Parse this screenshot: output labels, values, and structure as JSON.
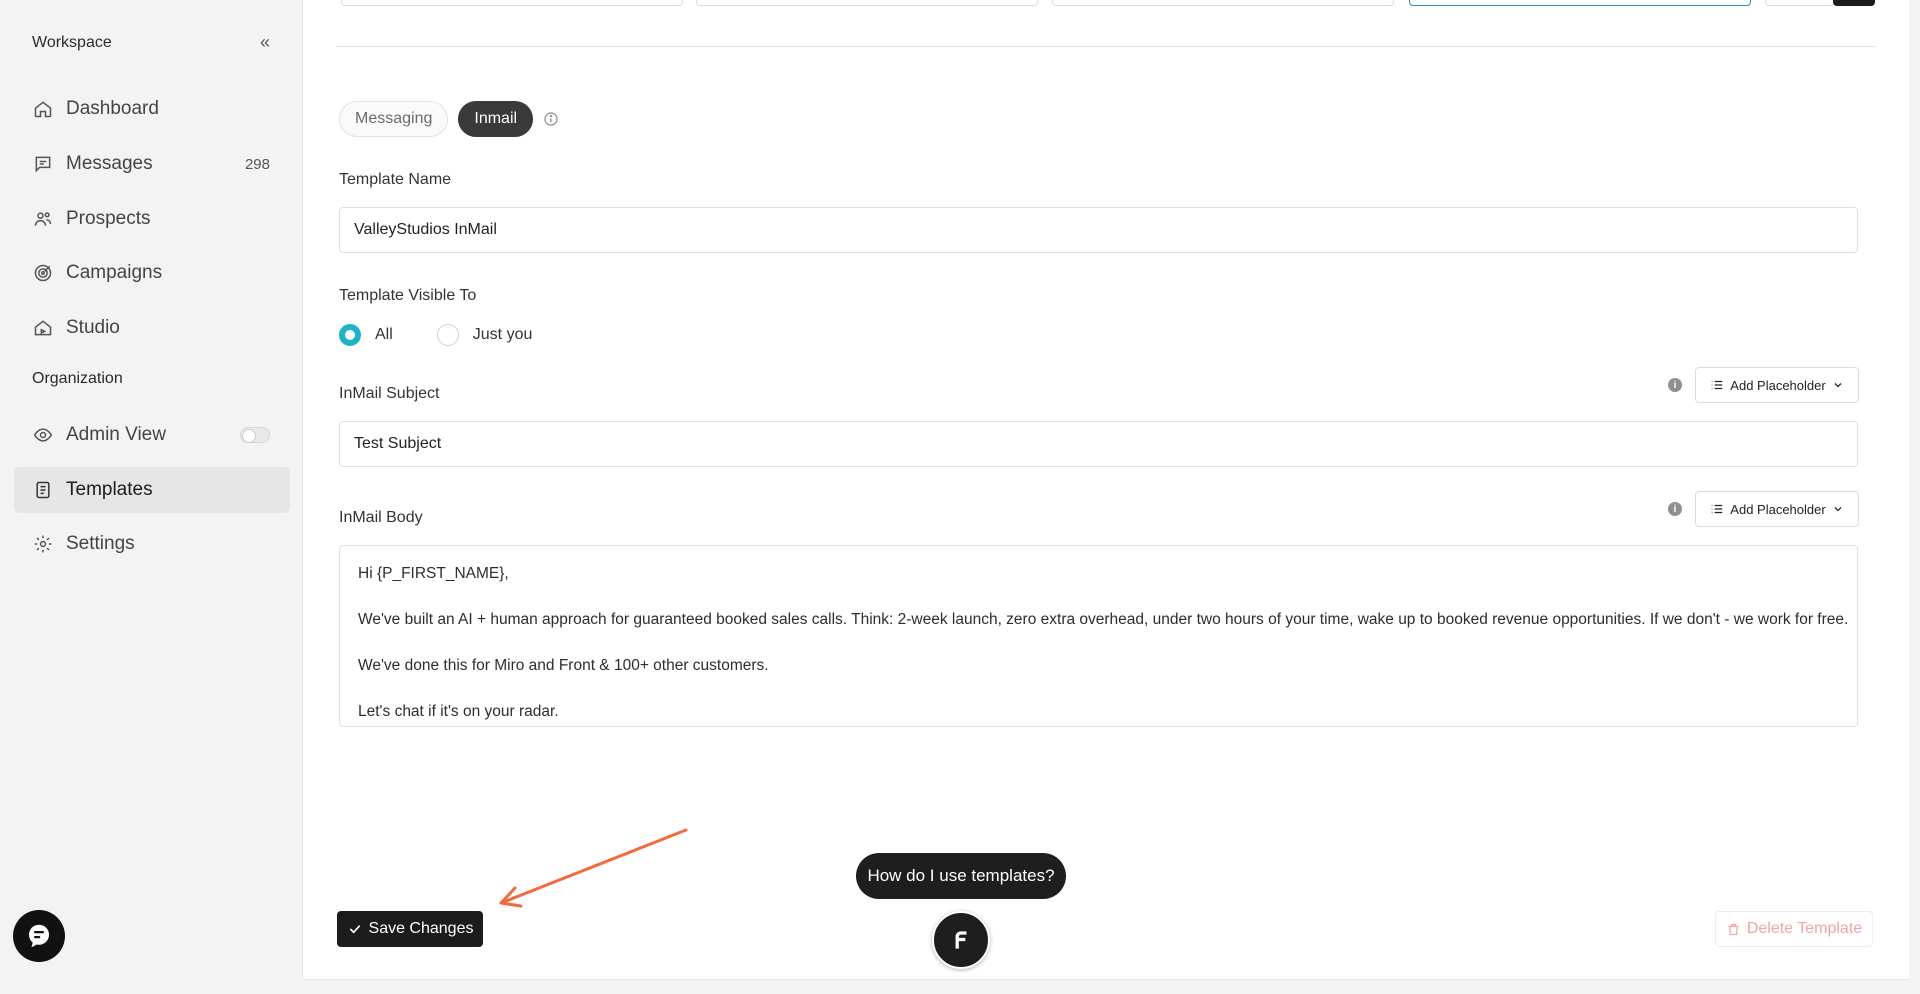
{
  "sidebar": {
    "workspace_label": "Workspace",
    "collapse_glyph": "«",
    "items": [
      {
        "label": "Dashboard",
        "icon": "home-icon"
      },
      {
        "label": "Messages",
        "icon": "message-icon",
        "count": "298"
      },
      {
        "label": "Prospects",
        "icon": "users-icon"
      },
      {
        "label": "Campaigns",
        "icon": "target-icon"
      },
      {
        "label": "Studio",
        "icon": "studio-icon"
      }
    ],
    "organization_label": "Organization",
    "org_items": [
      {
        "label": "Admin View",
        "icon": "eye-icon",
        "toggle": false
      },
      {
        "label": "Templates",
        "icon": "document-icon",
        "active": true
      },
      {
        "label": "Settings",
        "icon": "gear-icon"
      }
    ]
  },
  "tabs": {
    "messaging": "Messaging",
    "inmail": "Inmail",
    "active": "Inmail"
  },
  "form": {
    "template_name_label": "Template Name",
    "template_name_value": "ValleyStudios InMail",
    "visible_to_label": "Template Visible To",
    "visibility_options": [
      "All",
      "Just you"
    ],
    "visibility_selected": "All",
    "subject_label": "InMail Subject",
    "subject_value": "Test Subject",
    "body_label": "InMail Body",
    "add_placeholder_label": "Add Placeholder",
    "body_paragraphs": [
      "Hi {P_FIRST_NAME},",
      "We've built an AI + human approach for guaranteed booked sales calls. Think: 2-week launch, zero extra overhead, under two hours of your time, wake up to booked revenue opportunities. If we don't - we work for free.",
      "We've done this for Miro and Front & 100+ other customers.",
      "Let's chat if it's on your radar."
    ]
  },
  "actions": {
    "save_label": "Save Changes",
    "delete_label": "Delete Template",
    "help_label": "How do I use templates?"
  },
  "colors": {
    "accent_radio": "#1eb3c6",
    "dark_button": "#1c1c1c",
    "annotation_arrow": "#f26a3d",
    "delete_text": "#f2a4a4"
  }
}
